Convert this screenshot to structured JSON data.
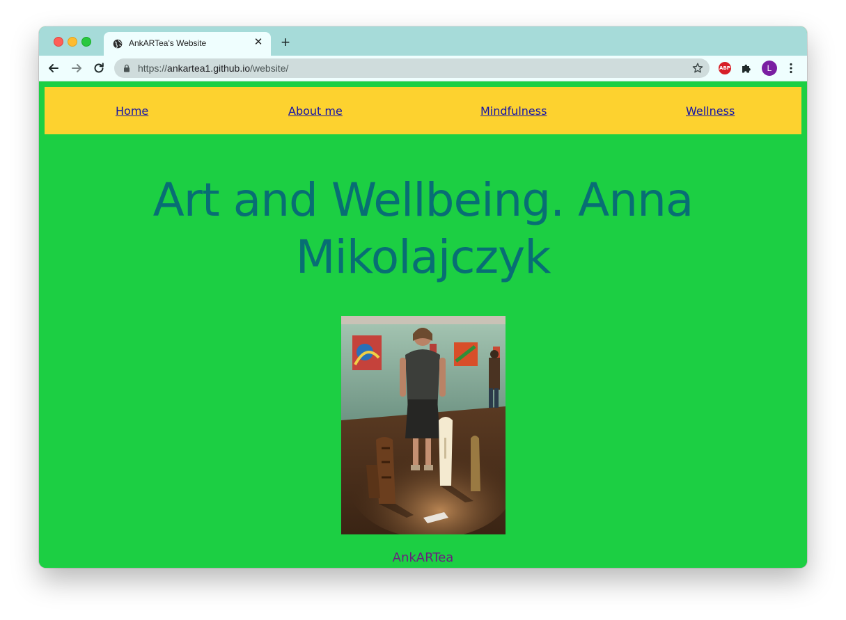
{
  "browser": {
    "tab": {
      "title": "AnkARTea's Website",
      "close_icon": "close-icon",
      "favicon": "globe-icon"
    },
    "new_tab_icon": "plus-icon",
    "toolbar": {
      "back_icon": "arrow-left-icon",
      "forward_icon": "arrow-right-icon",
      "reload_icon": "reload-icon",
      "url_prefix": "https://",
      "url_host": "ankartea1.github.io",
      "url_path": "/website/",
      "star_icon": "star-icon",
      "extension_abp_label": "ABP",
      "extension_icon": "puzzle-icon",
      "profile_initial": "L",
      "menu_icon": "kebab-menu-icon"
    }
  },
  "page": {
    "nav": {
      "items": [
        {
          "label": "Home"
        },
        {
          "label": "About me"
        },
        {
          "label": "Mindfulness"
        },
        {
          "label": "Wellness"
        }
      ]
    },
    "heading_line1": "Art and Wellbeing. Anna",
    "heading_line2": "Mikolajczyk",
    "caption": "AnkARTea",
    "colors": {
      "background": "#1ccf43",
      "nav_background": "#fdd22f",
      "link": "#1414a8",
      "heading": "#086e74",
      "caption": "#6a1f7f"
    }
  }
}
